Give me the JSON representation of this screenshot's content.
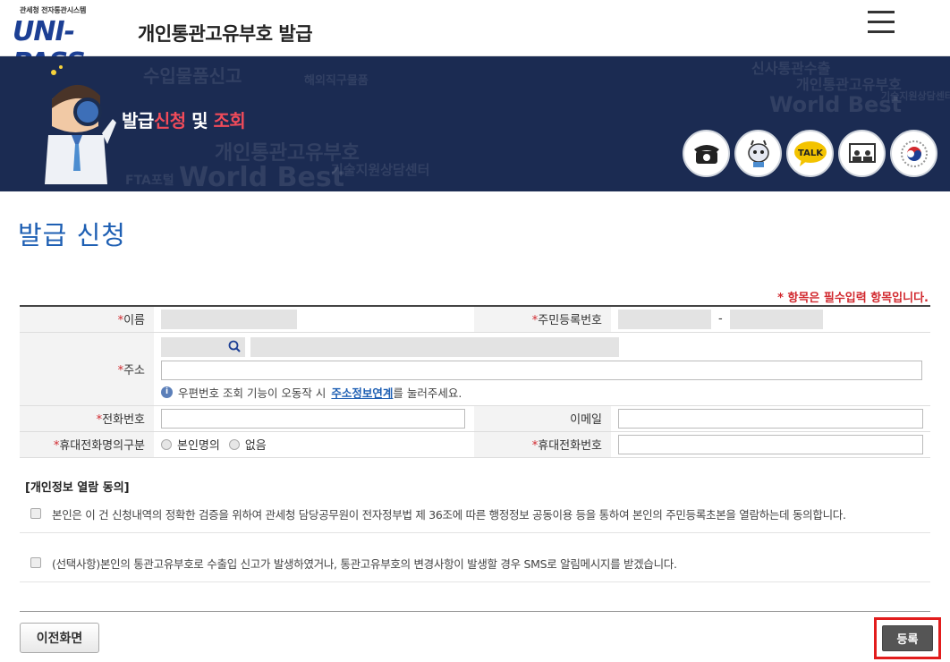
{
  "header": {
    "logo_sub": "관세청 전자통관시스템",
    "logo_brand": "UNI-PASS",
    "site_title": "개인통관고유부호 발급"
  },
  "banner": {
    "title_part1": "발급",
    "title_part2": "신청",
    "title_part3": " 및 ",
    "title_part4": "조회",
    "icons": [
      "phone-icon",
      "chatbot-icon",
      "talk-icon",
      "video-call-icon",
      "gov-emblem-icon"
    ],
    "talk_label": "TALK"
  },
  "page": {
    "title": "발급 신청",
    "required_note": "* 항목은 필수입력 항목입니다."
  },
  "form": {
    "name_label": "이름",
    "rrn_label": "주민등록번호",
    "rrn_dash": "-",
    "address_label": "주소",
    "address_info_prefix": "우편번호 조회 기능이 오동작 시 ",
    "address_info_link": "주소정보연계",
    "address_info_suffix": "를 눌러주세요.",
    "phone_label": "전화번호",
    "email_label": "이메일",
    "mobile_owner_label": "휴대전화명의구분",
    "mobile_owner_opt1": "본인명의",
    "mobile_owner_opt2": "없음",
    "mobile_label": "휴대전화번호",
    "req_mark": "*"
  },
  "consent": {
    "title": "[개인정보 열람 동의]",
    "item1": "본인은 이 건 신청내역의 정확한 검증을 위하여 관세청 담당공무원이 전자정부법 제 36조에 따른 행정정보 공동이용 등을 통하여 본인의 주민등록초본을 열람하는데 동의합니다.",
    "item2": "(선택사항)본인의 통관고유부호로 수출입 신고가 발생하였거나, 통관고유부호의 변경사항이 발생할 경우 SMS로 알림메시지를 받겠습니다."
  },
  "buttons": {
    "prev": "이전화면",
    "register": "등록"
  },
  "colors": {
    "brand_blue": "#1c3f94",
    "title_blue": "#1e5fb3",
    "required_red": "#d1282e",
    "banner_bg": "#1b2b52",
    "highlight_border": "#e21d1d"
  }
}
